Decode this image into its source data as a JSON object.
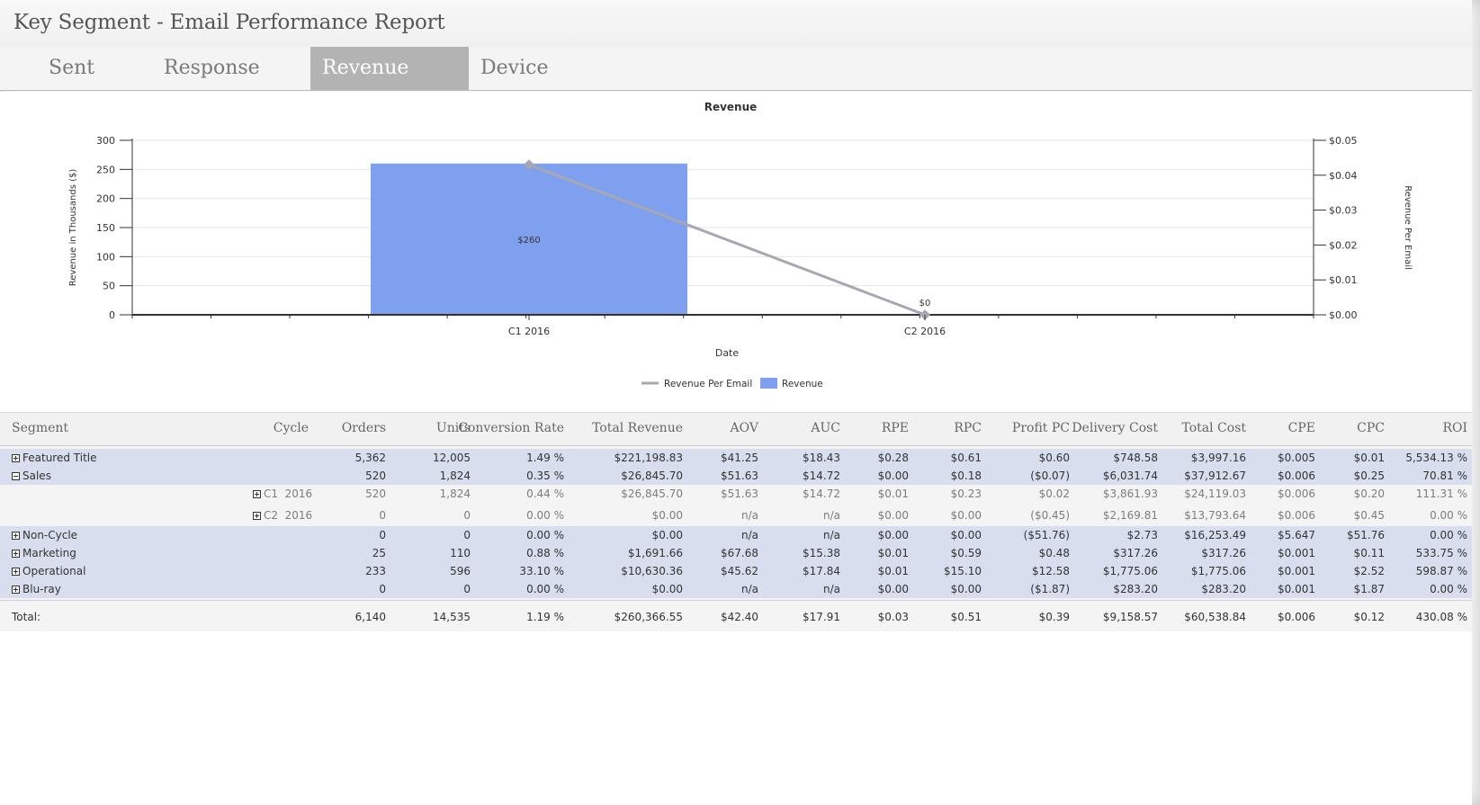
{
  "report": {
    "title": "Key Segment - Email Performance Report"
  },
  "tabs": [
    {
      "label": "Sent",
      "active": false
    },
    {
      "label": "Response",
      "active": false
    },
    {
      "label": "Revenue",
      "active": true
    },
    {
      "label": "Device",
      "active": false
    }
  ],
  "chart_data": {
    "type": "bar",
    "title": "Revenue",
    "xlabel": "Date",
    "ylabel": "Revenue in Thousands ($)",
    "y2label": "Revenue Per Email",
    "categories": [
      "C1  2016",
      "C2  2016"
    ],
    "ylim": [
      0,
      300
    ],
    "y_ticks": [
      "0",
      "50",
      "100",
      "150",
      "200",
      "250",
      "300"
    ],
    "y2lim": [
      0,
      0.05
    ],
    "y2_ticks": [
      "$0.00",
      "$0.01",
      "$0.02",
      "$0.03",
      "$0.04",
      "$0.05"
    ],
    "series": [
      {
        "name": "Revenue",
        "kind": "bar",
        "axis": "left",
        "values": [
          260,
          0
        ],
        "labels": [
          "$260",
          "$0"
        ],
        "color": "#7f9fef"
      },
      {
        "name": "Revenue Per Email",
        "kind": "line",
        "axis": "right",
        "values": [
          0.043,
          0.0
        ],
        "color": "#a7a7b3"
      }
    ],
    "grid": true,
    "legend": "bottom-center"
  },
  "table": {
    "columns": [
      "Segment",
      "Cycle",
      "Orders",
      "Units",
      "Conversion Rate",
      "Total Revenue",
      "AOV",
      "AUC",
      "RPE",
      "RPC",
      "Profit PC",
      "Delivery Cost",
      "Total Cost",
      "CPE",
      "CPC",
      "ROI"
    ],
    "rows": [
      {
        "type": "seg",
        "expander": "plus",
        "segment": "Featured Title",
        "cycle": "",
        "values": [
          "5,362",
          "12,005",
          "1.49 %",
          "$221,198.83",
          "$41.25",
          "$18.43",
          "$0.28",
          "$0.61",
          "$0.60",
          "$748.58",
          "$3,997.16",
          "$0.005",
          "$0.01",
          "5,534.13 %"
        ]
      },
      {
        "type": "seg",
        "expander": "minus",
        "segment": "Sales",
        "cycle": "",
        "values": [
          "520",
          "1,824",
          "0.35 %",
          "$26,845.70",
          "$51.63",
          "$14.72",
          "$0.00",
          "$0.18",
          "($0.07)",
          "$6,031.74",
          "$37,912.67",
          "$0.006",
          "$0.25",
          "70.81 %"
        ]
      },
      {
        "type": "sub",
        "expander": "plus",
        "segment": "",
        "cycle": "C1  2016",
        "values": [
          "520",
          "1,824",
          "0.44 %",
          "$26,845.70",
          "$51.63",
          "$14.72",
          "$0.01",
          "$0.23",
          "$0.02",
          "$3,861.93",
          "$24,119.03",
          "$0.006",
          "$0.20",
          "111.31 %"
        ]
      },
      {
        "type": "sub",
        "expander": "plus",
        "segment": "",
        "cycle": "C2  2016",
        "values": [
          "0",
          "0",
          "0.00 %",
          "$0.00",
          "n/a",
          "n/a",
          "$0.00",
          "$0.00",
          "($0.45)",
          "$2,169.81",
          "$13,793.64",
          "$0.006",
          "$0.45",
          "0.00 %"
        ]
      },
      {
        "type": "seg",
        "expander": "plus",
        "segment": "Non-Cycle",
        "cycle": "",
        "values": [
          "0",
          "0",
          "0.00 %",
          "$0.00",
          "n/a",
          "n/a",
          "$0.00",
          "$0.00",
          "($51.76)",
          "$2.73",
          "$16,253.49",
          "$5.647",
          "$51.76",
          "0.00 %"
        ]
      },
      {
        "type": "seg",
        "expander": "plus",
        "segment": "Marketing",
        "cycle": "",
        "values": [
          "25",
          "110",
          "0.88 %",
          "$1,691.66",
          "$67.68",
          "$15.38",
          "$0.01",
          "$0.59",
          "$0.48",
          "$317.26",
          "$317.26",
          "$0.001",
          "$0.11",
          "533.75 %"
        ]
      },
      {
        "type": "seg",
        "expander": "plus",
        "segment": "Operational",
        "cycle": "",
        "values": [
          "233",
          "596",
          "33.10 %",
          "$10,630.36",
          "$45.62",
          "$17.84",
          "$0.01",
          "$15.10",
          "$12.58",
          "$1,775.06",
          "$1,775.06",
          "$0.001",
          "$2.52",
          "598.87 %"
        ]
      },
      {
        "type": "seg",
        "expander": "plus",
        "segment": "Blu-ray",
        "cycle": "",
        "values": [
          "0",
          "0",
          "0.00 %",
          "$0.00",
          "n/a",
          "n/a",
          "$0.00",
          "$0.00",
          "($1.87)",
          "$283.20",
          "$283.20",
          "$0.001",
          "$1.87",
          "0.00 %"
        ]
      }
    ],
    "total": {
      "label": "Total:",
      "values": [
        "6,140",
        "14,535",
        "1.19 %",
        "$260,366.55",
        "$42.40",
        "$17.91",
        "$0.03",
        "$0.51",
        "$0.39",
        "$9,158.57",
        "$60,538.84",
        "$0.006",
        "$0.12",
        "430.08 %"
      ]
    }
  }
}
